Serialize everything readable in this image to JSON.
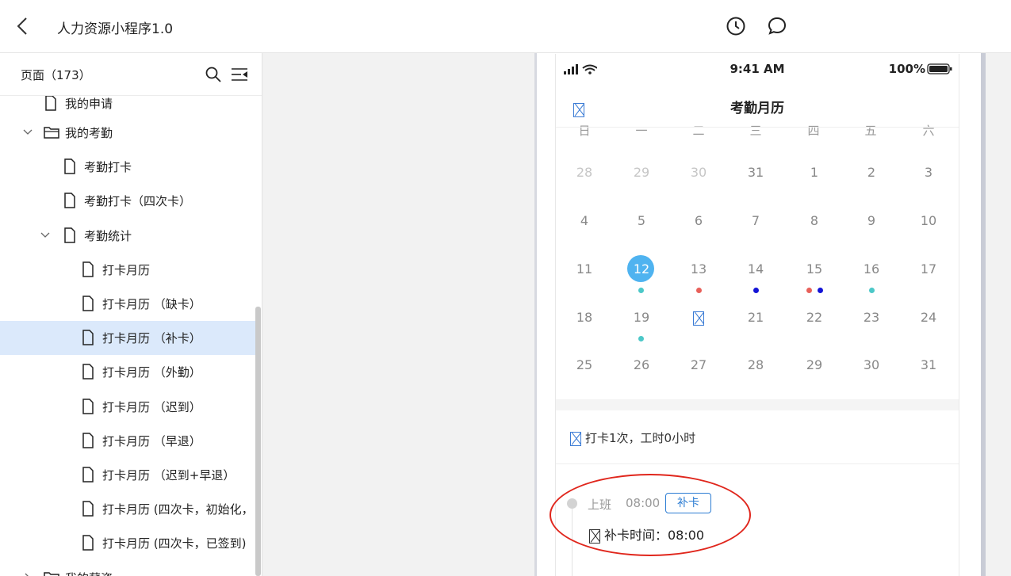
{
  "header": {
    "title": "人力资源小程序1.0",
    "back_icon": "back-arrow-icon",
    "history_icon": "clock-icon",
    "comment_icon": "comment-icon"
  },
  "sidebar": {
    "pages_label": "页面（173）",
    "items": [
      {
        "label": "我的申请",
        "type": "file"
      },
      {
        "label": "我的考勤",
        "type": "folder",
        "expanded": true
      },
      {
        "label": "考勤打卡",
        "type": "file"
      },
      {
        "label": "考勤打卡（四次卡）",
        "type": "file"
      },
      {
        "label": "考勤统计",
        "type": "file",
        "expanded": true
      },
      {
        "label": "打卡月历",
        "type": "file"
      },
      {
        "label": "打卡月历 （缺卡）",
        "type": "file"
      },
      {
        "label": "打卡月历 （补卡）",
        "type": "file",
        "selected": true
      },
      {
        "label": "打卡月历 （外勤）",
        "type": "file"
      },
      {
        "label": "打卡月历 （迟到）",
        "type": "file"
      },
      {
        "label": "打卡月历 （早退）",
        "type": "file"
      },
      {
        "label": "打卡月历 （迟到+早退）",
        "type": "file"
      },
      {
        "label": "打卡月历 (四次卡，初始化，",
        "type": "file"
      },
      {
        "label": "打卡月历 (四次卡，已签到)",
        "type": "file"
      },
      {
        "label": "我的薪资",
        "type": "folder"
      }
    ]
  },
  "phone": {
    "status_time": "9:41 AM",
    "battery": "100%",
    "nav_title": "考勤月历",
    "weekdays": [
      "日",
      "一",
      "二",
      "三",
      "四",
      "五",
      "六"
    ],
    "weeks": [
      [
        "28",
        "29",
        "30",
        "31",
        "1",
        "2",
        "3"
      ],
      [
        "4",
        "5",
        "6",
        "7",
        "8",
        "9",
        "10"
      ],
      [
        "11",
        "12",
        "13",
        "14",
        "15",
        "16",
        "17"
      ],
      [
        "18",
        "19",
        "",
        "21",
        "22",
        "23",
        "24"
      ],
      [
        "25",
        "26",
        "27",
        "28",
        "29",
        "30",
        "31"
      ]
    ],
    "selected_day": "12",
    "colors": {
      "today": "#4fb3f0",
      "red": "#e8605a",
      "blue": "#1414d6",
      "teal": "#4cc8c8",
      "tag": "#2b7cd3",
      "annotation": "#e0261c",
      "selected_row": "#dbe9fb"
    },
    "summary": "打卡1次，工时0小时",
    "record": {
      "shift": "上班",
      "time": "08:00",
      "tag": "补卡",
      "remark": "补卡时间：08:00"
    }
  }
}
